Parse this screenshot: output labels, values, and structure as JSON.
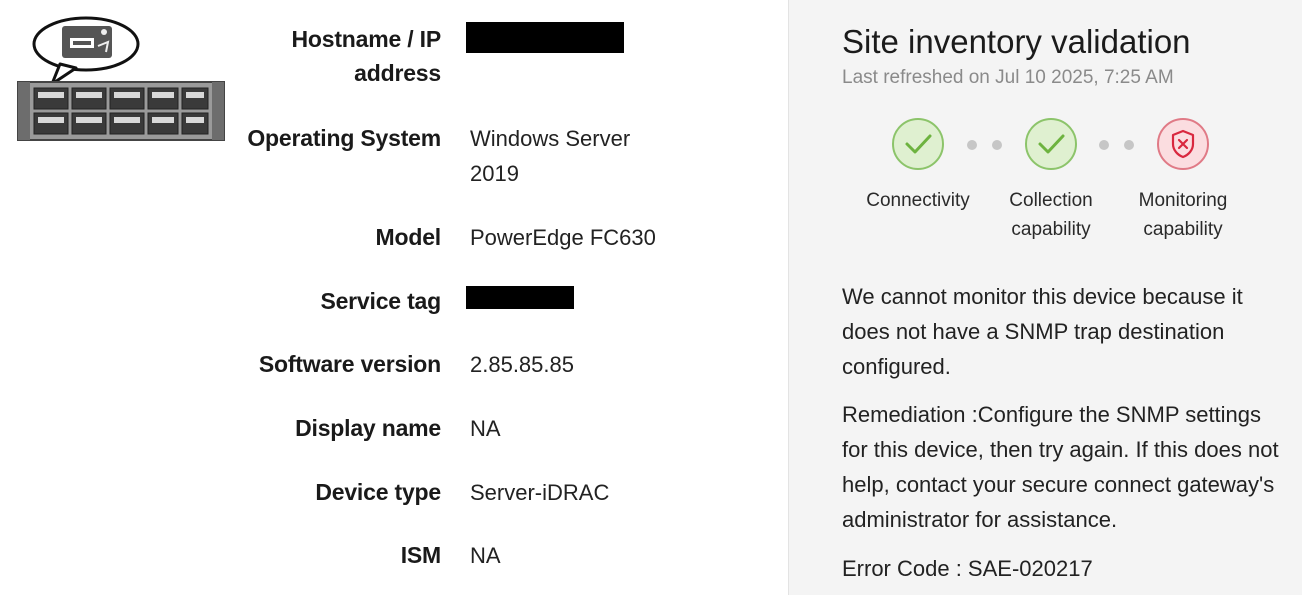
{
  "device": {
    "fields": [
      {
        "key": "hostname",
        "label": "Hostname / IP address",
        "value": ""
      },
      {
        "key": "os",
        "label": "Operating System",
        "value": "Windows Server 2019"
      },
      {
        "key": "model",
        "label": "Model",
        "value": "PowerEdge FC630"
      },
      {
        "key": "service_tag",
        "label": "Service tag",
        "value": ""
      },
      {
        "key": "software",
        "label": "Software version",
        "value": "2.85.85.85"
      },
      {
        "key": "display_name",
        "label": "Display name",
        "value": "NA"
      },
      {
        "key": "device_type",
        "label": "Device type",
        "value": "Server-iDRAC"
      },
      {
        "key": "ism",
        "label": "ISM",
        "value": "NA"
      }
    ]
  },
  "panel": {
    "title": "Site inventory validation",
    "refreshed": "Last refreshed on Jul 10 2025, 7:25 AM",
    "steps": [
      {
        "label_line1": "Connectivity",
        "label_line2": "",
        "status": "success",
        "icon": "check-icon"
      },
      {
        "label_line1": "Collection",
        "label_line2": "capability",
        "status": "success",
        "icon": "check-icon"
      },
      {
        "label_line1": "Monitoring",
        "label_line2": "capability",
        "status": "error",
        "icon": "shield-x-icon"
      }
    ],
    "message": "We cannot monitor this device because it does not have a SNMP trap destination configured.",
    "remediation": "Remediation :Configure the SNMP settings for this device, then try again. If this does not help, contact your secure connect gateway's administrator for assistance.",
    "error_code": "Error Code : SAE-020217"
  },
  "colors": {
    "success_fill": "#dff0d0",
    "success_stroke": "#6db33f",
    "error_fill": "#fbdde0",
    "error_stroke": "#d9283f",
    "panel_bg": "#f4f4f4",
    "muted_text": "#8a8a8a"
  }
}
